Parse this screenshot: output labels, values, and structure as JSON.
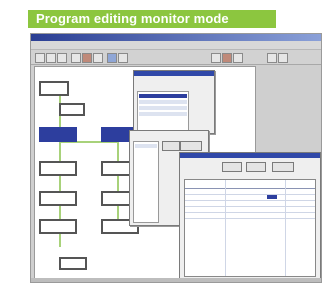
{
  "caption": "Program editing monitor mode",
  "accent_color": "#8cc63f"
}
